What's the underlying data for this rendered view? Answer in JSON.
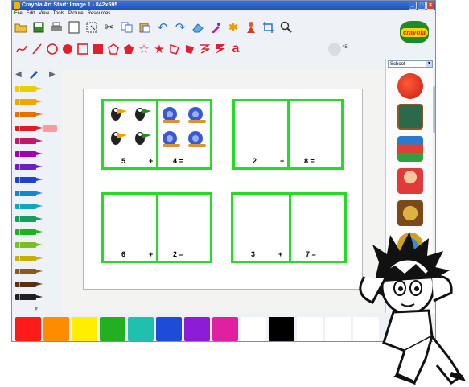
{
  "window": {
    "title": "Crayola Art Start: Image 1 - 842x595"
  },
  "menu": [
    "File",
    "Edit",
    "View",
    "Tools",
    "Picture",
    "Resources"
  ],
  "logo_text": "crayola",
  "size_label": "45",
  "category": "School",
  "problems": [
    {
      "left": "5",
      "op": "+",
      "right": "4 ="
    },
    {
      "left": "2",
      "op": "+",
      "right": "8 ="
    },
    {
      "left": "6",
      "op": "+",
      "right": "2 ="
    },
    {
      "left": "3",
      "op": "+",
      "right": "7 ="
    }
  ],
  "crayon_colors": [
    "#e8d000",
    "#f0a500",
    "#e87000",
    "#e01b22",
    "#c0186a",
    "#a000b0",
    "#6a20c0",
    "#2040d0",
    "#1088d0",
    "#10a8b8",
    "#10a060",
    "#20b020",
    "#78c020",
    "#c8b000",
    "#8a5a20",
    "#5a3010",
    "#202020"
  ],
  "swatch_colors": [
    "#ff1a1a",
    "#ff8c00",
    "#ffee00",
    "#22b022",
    "#20c0b0",
    "#1c4cd8",
    "#8c1cd8",
    "#e020a0",
    "#ffffff",
    "#000000",
    "#ffffff",
    "#ffffff",
    "#ffffff"
  ],
  "thumbnails": [
    "apple-sticker",
    "chalkboard-sticker",
    "books-sticker",
    "student-sticker",
    "mask-sticker",
    "globe-sticker"
  ],
  "icons": {
    "toolbar": [
      "folder-open-icon",
      "save-icon",
      "print-icon",
      "new-page-icon",
      "select-icon",
      "cut-icon",
      "copy-icon",
      "paste-icon",
      "undo-icon",
      "redo-icon",
      "eraser-icon",
      "dropper-icon",
      "stamp-icon",
      "stick-figure-icon",
      "crop-icon",
      "zoom-icon"
    ],
    "shapes": [
      "curve-icon",
      "line-icon",
      "circle-outline-icon",
      "circle-filled-icon",
      "square-outline-icon",
      "square-filled-icon",
      "pentagon-outline-icon",
      "pentagon-filled-icon",
      "star-outline-icon",
      "star-filled-icon",
      "freeform-outline-icon",
      "freeform-filled-icon",
      "zigzag-outline-icon",
      "zigzag-filled-icon",
      "text-icon"
    ]
  }
}
